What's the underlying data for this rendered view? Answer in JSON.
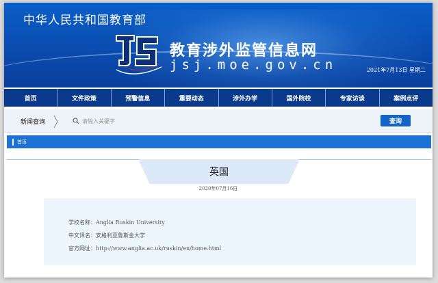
{
  "header": {
    "ministry": "中华人民共和国教育部",
    "site_title": "教育涉外监管信息网",
    "domain": "jsj.moe.gov.cn",
    "date": "2021年7月13日 星期二"
  },
  "nav": {
    "items": [
      "首页",
      "文件政策",
      "预警信息",
      "重要动态",
      "涉外办学",
      "国外院校",
      "专家访谈",
      "案例点评"
    ]
  },
  "search": {
    "label": "新闻查询",
    "placeholder": "请输入关键字",
    "button": "查询"
  },
  "breadcrumb": {
    "home": "首页"
  },
  "article": {
    "title": "英国",
    "date": "2020年07月16日",
    "lines": [
      "学校名称：Anglia Ruskin University",
      "中文译名：安格利亚鲁斯金大学",
      "官方网址：http://www.anglia.ac.uk/ruskin/en/home.html"
    ]
  },
  "colors": {
    "banner": "#0a4fb4",
    "nav": "#0a3a8c",
    "accent": "#1d72d6",
    "logo_red": "#d8242a"
  }
}
